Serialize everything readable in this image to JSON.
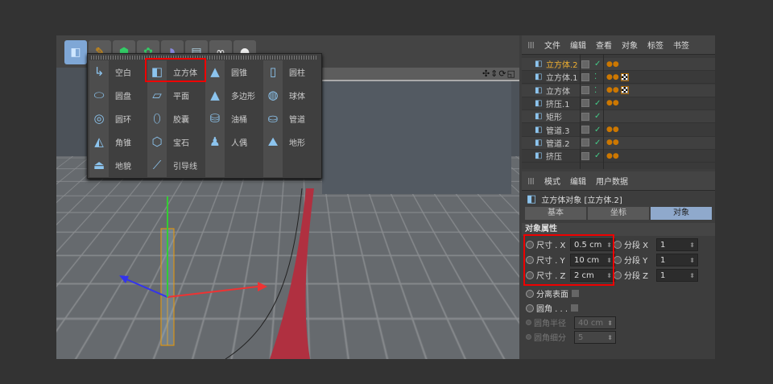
{
  "toolbar": {
    "icons": [
      "cube-icon",
      "pen-icon",
      "subdivision-icon",
      "cloner-icon",
      "deformer-icon",
      "scene-floor-icon",
      "camera-icon",
      "light-icon"
    ]
  },
  "viewport": {
    "header_icons": "✣⇕⟳◱"
  },
  "popup": {
    "items": [
      {
        "label": "空白",
        "icon": "null-icon"
      },
      {
        "label": "圆盘",
        "icon": "disc-icon"
      },
      {
        "label": "圆环",
        "icon": "torus-icon"
      },
      {
        "label": "角锥",
        "icon": "pyramid-icon"
      },
      {
        "label": "地貌",
        "icon": "landscape-icon"
      },
      {
        "label": "立方体",
        "icon": "cube-icon"
      },
      {
        "label": "平面",
        "icon": "plane-icon"
      },
      {
        "label": "胶囊",
        "icon": "capsule-icon"
      },
      {
        "label": "宝石",
        "icon": "gem-icon"
      },
      {
        "label": "引导线",
        "icon": "guide-icon"
      },
      {
        "label": "圆锥",
        "icon": "cone-icon"
      },
      {
        "label": "多边形",
        "icon": "polygon-icon"
      },
      {
        "label": "油桶",
        "icon": "oil-tank-icon"
      },
      {
        "label": "人偶",
        "icon": "figure-icon"
      },
      {
        "label": "圆柱",
        "icon": "cylinder-icon"
      },
      {
        "label": "球体",
        "icon": "sphere-icon"
      },
      {
        "label": "管道",
        "icon": "tube-icon"
      },
      {
        "label": "地形",
        "icon": "landscape-terrain-icon"
      }
    ]
  },
  "object_manager": {
    "menu": [
      "文件",
      "编辑",
      "查看",
      "对象",
      "标签",
      "书签"
    ],
    "objects": [
      {
        "name": "立方体.2",
        "selected": true,
        "check": true,
        "tex": false
      },
      {
        "name": "立方体.1",
        "check": false,
        "tex": true
      },
      {
        "name": "立方体",
        "check": false,
        "tex": true
      },
      {
        "name": "挤压.1",
        "check": true,
        "tex": false
      },
      {
        "name": "矩形",
        "check": true,
        "tex": false,
        "notag": true
      },
      {
        "name": "管道.3",
        "check": true,
        "tex": false
      },
      {
        "name": "管道.2",
        "check": true,
        "tex": false
      },
      {
        "name": "挤压",
        "check": true,
        "tex": false
      }
    ]
  },
  "attributes": {
    "menu": [
      "模式",
      "编辑",
      "用户数据"
    ],
    "title": "立方体对象 [立方体.2]",
    "tabs": [
      "基本",
      "坐标",
      "对象"
    ],
    "active_tab": "对象",
    "section": "对象属性",
    "size_x_label": "尺寸 . X",
    "size_x": "0.5 cm",
    "size_y_label": "尺寸 . Y",
    "size_y": "10 cm",
    "size_z_label": "尺寸 . Z",
    "size_z": "2 cm",
    "seg_x_label": "分段 X",
    "seg_x": "1",
    "seg_y_label": "分段 Y",
    "seg_y": "1",
    "seg_z_label": "分段 Z",
    "seg_z": "1",
    "separate_label": "分离表面",
    "fillet_label": "圆角 . . .",
    "fillet_radius_label": "圆角半径",
    "fillet_radius": "40 cm",
    "fillet_sub_label": "圆角细分",
    "fillet_sub": "5"
  },
  "colors": {
    "highlight": "#e00000",
    "selected_text": "#f0b030",
    "active_tab": "#8fa9cc"
  }
}
